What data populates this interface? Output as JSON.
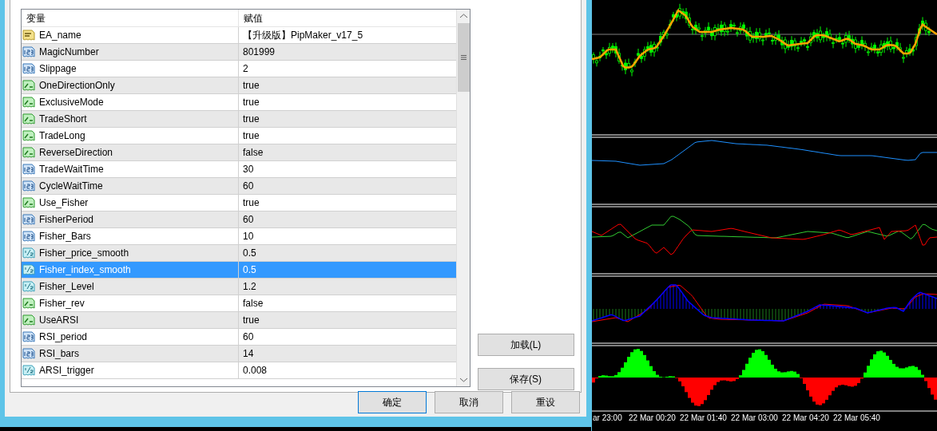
{
  "dialog": {
    "table": {
      "columns": [
        "变量",
        "赋值"
      ],
      "rows": [
        {
          "kind": "string",
          "name": "EA_name",
          "value": "【升级版】PipMaker_v17_5",
          "selected": false
        },
        {
          "kind": "int",
          "name": "MagicNumber",
          "value": "801999",
          "selected": false
        },
        {
          "kind": "int",
          "name": "Slippage",
          "value": "2",
          "selected": false
        },
        {
          "kind": "bool",
          "name": "OneDirectionOnly",
          "value": "true",
          "selected": false
        },
        {
          "kind": "bool",
          "name": "ExclusiveMode",
          "value": "true",
          "selected": false
        },
        {
          "kind": "bool",
          "name": "TradeShort",
          "value": "true",
          "selected": false
        },
        {
          "kind": "bool",
          "name": "TradeLong",
          "value": "true",
          "selected": false
        },
        {
          "kind": "bool",
          "name": "ReverseDirection",
          "value": "false",
          "selected": false
        },
        {
          "kind": "int",
          "name": "TradeWaitTime",
          "value": "30",
          "selected": false
        },
        {
          "kind": "int",
          "name": "CycleWaitTime",
          "value": "60",
          "selected": false
        },
        {
          "kind": "bool",
          "name": "Use_Fisher",
          "value": "true",
          "selected": false
        },
        {
          "kind": "int",
          "name": "FisherPeriod",
          "value": "60",
          "selected": false
        },
        {
          "kind": "int",
          "name": "Fisher_Bars",
          "value": "10",
          "selected": false
        },
        {
          "kind": "double",
          "name": "Fisher_price_smooth",
          "value": "0.5",
          "selected": false
        },
        {
          "kind": "double",
          "name": "Fisher_index_smooth",
          "value": "0.5",
          "selected": true
        },
        {
          "kind": "double",
          "name": "Fisher_Level",
          "value": "1.2",
          "selected": false
        },
        {
          "kind": "bool",
          "name": "Fisher_rev",
          "value": "false",
          "selected": false
        },
        {
          "kind": "bool",
          "name": "UseARSI",
          "value": "true",
          "selected": false
        },
        {
          "kind": "int",
          "name": "RSI_period",
          "value": "60",
          "selected": false
        },
        {
          "kind": "int",
          "name": "RSI_bars",
          "value": "14",
          "selected": false
        },
        {
          "kind": "double",
          "name": "ARSI_trigger",
          "value": "0.008",
          "selected": false
        }
      ]
    },
    "side_buttons": [
      "加载(L)",
      "保存(S)"
    ],
    "buttons": [
      {
        "label": "确定",
        "default": true
      },
      {
        "label": "取消",
        "default": false
      },
      {
        "label": "重设",
        "default": false
      }
    ]
  },
  "chart": {
    "time_labels": [
      "ar 23:00",
      "22 Mar 00:20",
      "22 Mar 01:40",
      "22 Mar 03:00",
      "22 Mar 04:20",
      "22 Mar 05:40"
    ]
  }
}
